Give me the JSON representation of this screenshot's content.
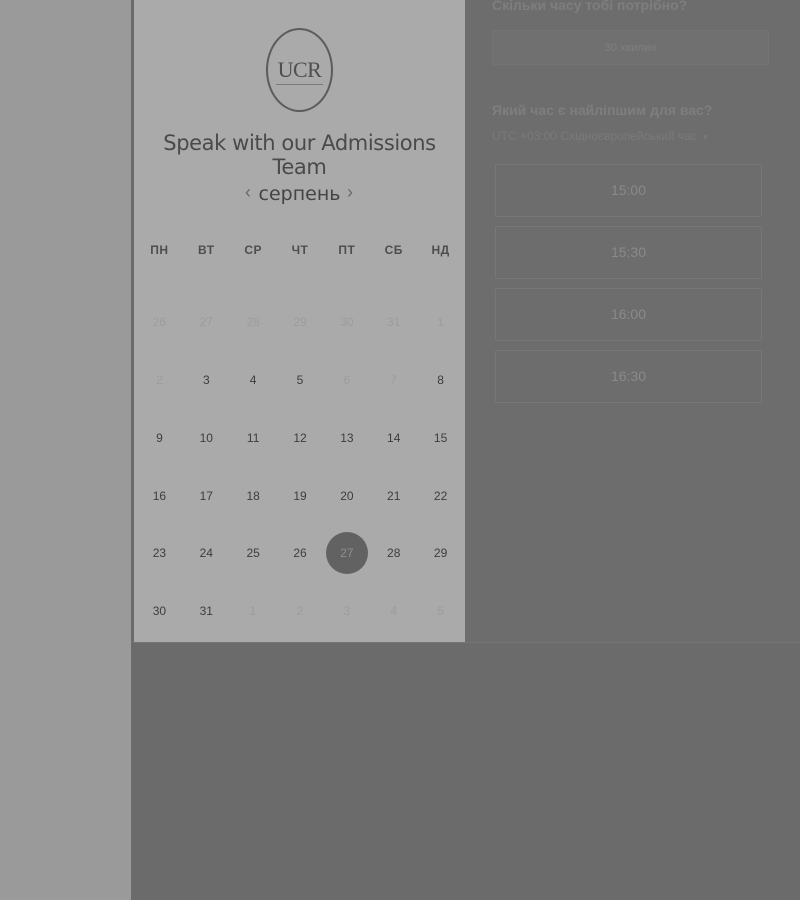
{
  "booking": {
    "logo_text": "UCR",
    "title": "Speak with our Admissions Team",
    "month": "серпень",
    "prev_arrow": "‹",
    "next_arrow": "›",
    "weekdays": [
      "ПН",
      "ВТ",
      "СР",
      "ЧТ",
      "ПТ",
      "СБ",
      "НД"
    ],
    "weeks": [
      [
        {
          "d": "26",
          "state": "muted"
        },
        {
          "d": "27",
          "state": "muted"
        },
        {
          "d": "28",
          "state": "muted"
        },
        {
          "d": "29",
          "state": "muted"
        },
        {
          "d": "30",
          "state": "muted"
        },
        {
          "d": "31",
          "state": "muted"
        },
        {
          "d": "1",
          "state": "muted"
        }
      ],
      [
        {
          "d": "2",
          "state": "muted"
        },
        {
          "d": "3",
          "state": "available"
        },
        {
          "d": "4",
          "state": "available"
        },
        {
          "d": "5",
          "state": "available"
        },
        {
          "d": "6",
          "state": "muted"
        },
        {
          "d": "7",
          "state": "muted"
        },
        {
          "d": "8",
          "state": "available"
        }
      ],
      [
        {
          "d": "9",
          "state": "available"
        },
        {
          "d": "10",
          "state": "available"
        },
        {
          "d": "11",
          "state": "available"
        },
        {
          "d": "12",
          "state": "available"
        },
        {
          "d": "13",
          "state": "available"
        },
        {
          "d": "14",
          "state": "available"
        },
        {
          "d": "15",
          "state": "available"
        }
      ],
      [
        {
          "d": "16",
          "state": "available"
        },
        {
          "d": "17",
          "state": "available"
        },
        {
          "d": "18",
          "state": "available"
        },
        {
          "d": "19",
          "state": "available"
        },
        {
          "d": "20",
          "state": "available"
        },
        {
          "d": "21",
          "state": "available"
        },
        {
          "d": "22",
          "state": "available"
        }
      ],
      [
        {
          "d": "23",
          "state": "available"
        },
        {
          "d": "24",
          "state": "available"
        },
        {
          "d": "25",
          "state": "available"
        },
        {
          "d": "26",
          "state": "available"
        },
        {
          "d": "27",
          "state": "selected"
        },
        {
          "d": "28",
          "state": "available"
        },
        {
          "d": "29",
          "state": "available"
        }
      ],
      [
        {
          "d": "30",
          "state": "available"
        },
        {
          "d": "31",
          "state": "available"
        },
        {
          "d": "1",
          "state": "muted"
        },
        {
          "d": "2",
          "state": "muted"
        },
        {
          "d": "3",
          "state": "muted"
        },
        {
          "d": "4",
          "state": "muted"
        },
        {
          "d": "5",
          "state": "muted"
        }
      ]
    ]
  },
  "scheduler": {
    "duration_question": "Скільки часу тобі потрібно?",
    "duration_value": "30 хвилин",
    "time_question": "Який час є найліпшим для вас?",
    "timezone": "UTC +03:00 Східноєвропейський час",
    "timezone_caret": "▾",
    "slots": [
      "15:00",
      "15:30",
      "16:00",
      "16:30"
    ]
  },
  "colors": {
    "overlay": "#6b6b6b",
    "card": "#aaaaaa",
    "selected_day": "#626262"
  }
}
